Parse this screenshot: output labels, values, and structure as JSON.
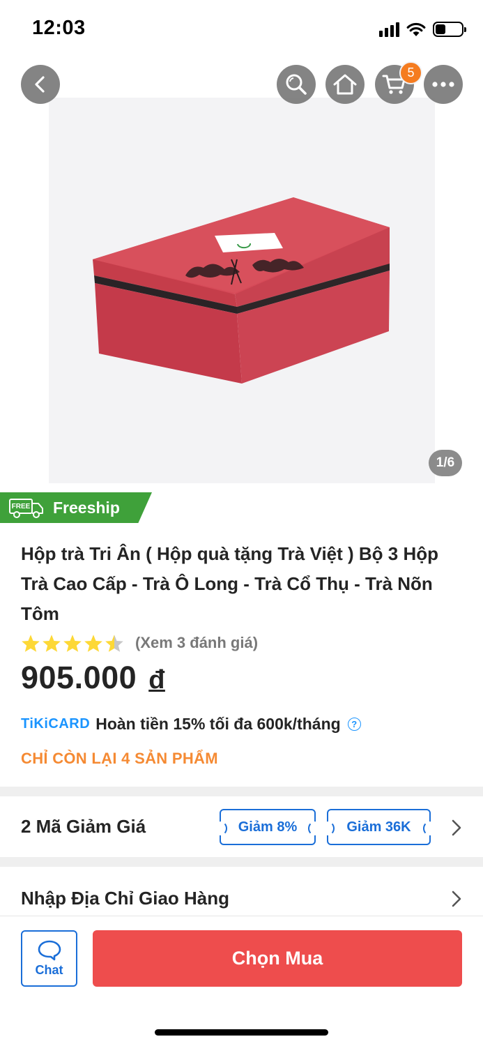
{
  "status_bar": {
    "time": "12:03",
    "icons": [
      "signal-icon",
      "wifi-icon",
      "battery-icon"
    ]
  },
  "top_nav": {
    "buttons": [
      "back-icon",
      "search-icon",
      "home-icon",
      "cart-icon",
      "more-icon"
    ],
    "cart_count": "5"
  },
  "gallery": {
    "counter": "1/6",
    "background_color": "#f3f3f5",
    "product_color": "#d8454f"
  },
  "freeship": {
    "icon_text": "FREE",
    "label": "Freeship",
    "color": "#3fa13a"
  },
  "product": {
    "title": "Hộp trà Tri Ân ( Hộp quà tặng Trà Việt ) Bộ 3 Hộp Trà Cao Cấp - Trà Ô Long - Trà Cổ Thụ - Trà Nõn Tôm",
    "rating": 4.5,
    "review_link": "(Xem 3 đánh giá)",
    "price": "905.000",
    "currency": "đ",
    "tikicard": {
      "logo_tiki": "TiKi",
      "logo_card": "CARD",
      "text": "Hoàn tiền 15% tối đa 600k/tháng",
      "help": "?"
    },
    "stock": "CHỈ CÒN LẠI 4 SẢN PHẨM"
  },
  "coupons": {
    "title": "2 Mã Giảm Giá",
    "items": [
      "Giảm 8%",
      "Giảm 36K"
    ]
  },
  "address": {
    "title": "Nhập Địa Chỉ Giao Hàng"
  },
  "bottom_bar": {
    "chat_label": "Chat",
    "buy_label": "Chọn Mua",
    "buy_color": "#ee4d4d",
    "accent_color": "#1a6ed8"
  }
}
